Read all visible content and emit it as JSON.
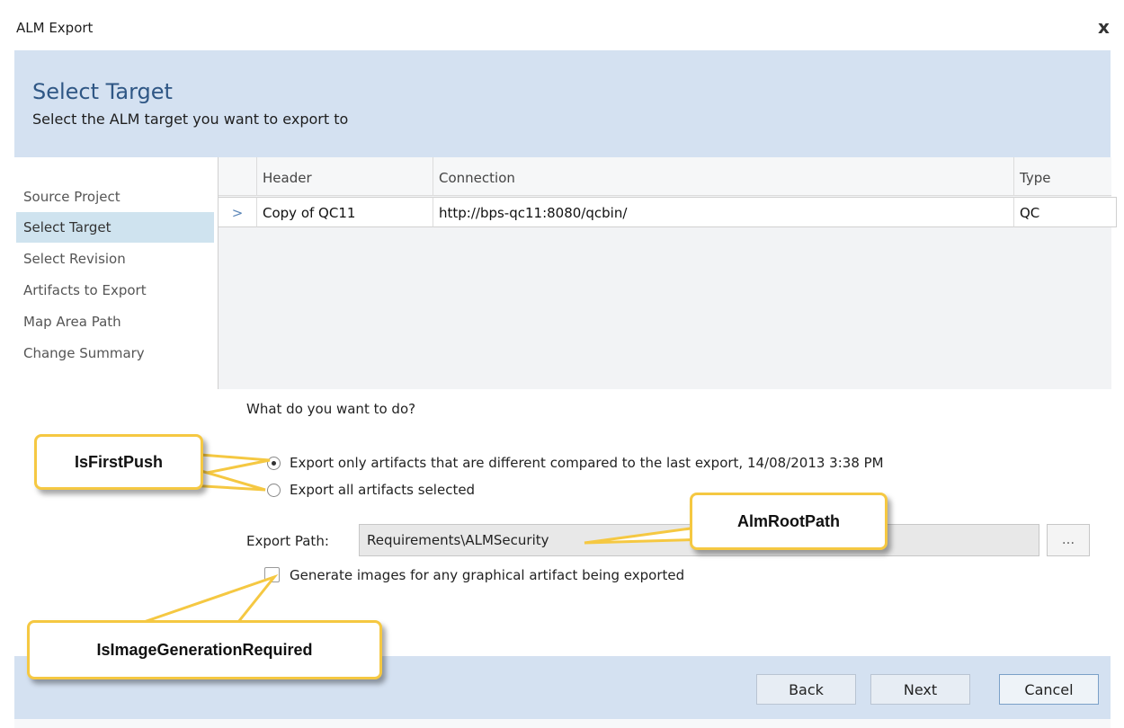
{
  "window": {
    "title": "ALM Export",
    "close_glyph": "x"
  },
  "header": {
    "title": "Select Target",
    "subtitle": "Select the ALM target you want to export to"
  },
  "nav": {
    "items": [
      "Source Project",
      "Select Target",
      "Select Revision",
      "Artifacts to Export",
      "Map Area Path",
      "Change Summary"
    ],
    "selected": "Select Target"
  },
  "grid": {
    "columns": [
      "Header",
      "Connection",
      "Type"
    ],
    "rows": [
      {
        "indicator": ">",
        "header": "Copy of QC11",
        "connection": "http://bps-qc11:8080/qcbin/",
        "type": "QC"
      }
    ]
  },
  "options": {
    "question": "What do you want to do?",
    "radio_diff_label": "Export only artifacts that are different compared to the last export, 14/08/2013 3:38 PM",
    "radio_all_label": "Export all artifacts selected",
    "radio_diff_checked": true,
    "export_path_label": "Export Path:",
    "export_path_value": "Requirements\\ALMSecurity",
    "browse_label": "...",
    "generate_images_label": "Generate images for any graphical artifact being exported",
    "generate_images_checked": false
  },
  "callouts": {
    "first_push": "IsFirstPush",
    "root_path": "AlmRootPath",
    "image_generation": "IsImageGenerationRequired"
  },
  "footer": {
    "back": "Back",
    "next": "Next",
    "cancel": "Cancel"
  },
  "colors": {
    "header_bg": "#d4e1f1",
    "title_blue": "#2f5785",
    "callout_border": "#f5c842",
    "nav_selected": "#cfe3ef"
  }
}
